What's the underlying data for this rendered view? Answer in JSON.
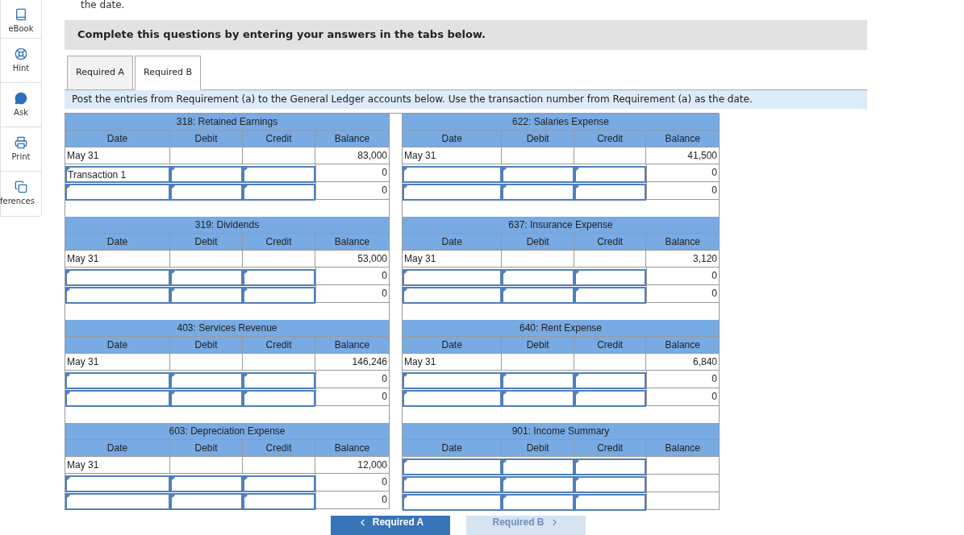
{
  "sidebar": {
    "items": [
      {
        "label": "eBook",
        "kind": "book"
      },
      {
        "label": "Hint",
        "kind": "lifebuoy"
      },
      {
        "label": "Ask",
        "kind": "chat"
      },
      {
        "label": "Print",
        "kind": "printer"
      },
      {
        "label": "ferences",
        "kind": "copies"
      }
    ]
  },
  "top_text": "the date.",
  "instructions": "Complete this questions by entering your answers in the tabs below.",
  "tabs": [
    {
      "label": "Required A",
      "selected": false
    },
    {
      "label": "Required B",
      "selected": true
    }
  ],
  "prompt": "Post the entries from Requirement (a) to the General Ledger accounts below. Use the transaction number from Requirement (a) as the date.",
  "ledgers": [
    {
      "title": "318: Retained Earnings",
      "columns": [
        "Date",
        "Debit",
        "Credit",
        "Balance"
      ],
      "rows": [
        {
          "kind": "fixed",
          "date": "May 31",
          "balance": "83,000"
        },
        {
          "kind": "input",
          "date": "Transaction 1",
          "balance": "0"
        },
        {
          "kind": "input",
          "balance": "0"
        }
      ]
    },
    {
      "title": "622: Salaries Expense",
      "columns": [
        "Date",
        "Debit",
        "Credit",
        "Balance"
      ],
      "rows": [
        {
          "kind": "fixed",
          "date": "May 31",
          "balance": "41,500"
        },
        {
          "kind": "input",
          "balance": "0"
        },
        {
          "kind": "input",
          "balance": "0"
        }
      ]
    },
    {
      "title": "319: Dividends",
      "columns": [
        "Date",
        "Debit",
        "Credit",
        "Balance"
      ],
      "rows": [
        {
          "kind": "fixed",
          "date": "May 31",
          "balance": "53,000"
        },
        {
          "kind": "input",
          "balance": "0"
        },
        {
          "kind": "input",
          "balance": "0"
        }
      ]
    },
    {
      "title": "637: Insurance Expense",
      "columns": [
        "Date",
        "Debit",
        "Credit",
        "Balance"
      ],
      "rows": [
        {
          "kind": "fixed",
          "date": "May 31",
          "balance": "3,120"
        },
        {
          "kind": "input",
          "balance": "0"
        },
        {
          "kind": "input",
          "balance": "0"
        }
      ]
    },
    {
      "title": "403: Services Revenue",
      "columns": [
        "Date",
        "Debit",
        "Credit",
        "Balance"
      ],
      "rows": [
        {
          "kind": "fixed",
          "date": "May 31",
          "balance": "146,246"
        },
        {
          "kind": "input",
          "balance": "0"
        },
        {
          "kind": "input",
          "balance": "0"
        }
      ]
    },
    {
      "title": "640: Rent Expense",
      "columns": [
        "Date",
        "Debit",
        "Credit",
        "Balance"
      ],
      "rows": [
        {
          "kind": "fixed",
          "date": "May 31",
          "balance": "6,840"
        },
        {
          "kind": "input",
          "balance": "0"
        },
        {
          "kind": "input",
          "balance": "0"
        }
      ]
    },
    {
      "title": "603: Depreciation Expense",
      "columns": [
        "Date",
        "Debit",
        "Credit",
        "Balance"
      ],
      "rows": [
        {
          "kind": "fixed",
          "date": "May 31",
          "balance": "12,000"
        },
        {
          "kind": "input",
          "balance": "0"
        },
        {
          "kind": "input",
          "balance": "0"
        }
      ]
    },
    {
      "title": "901: Income Summary",
      "columns": [
        "Date",
        "Debit",
        "Credit",
        "Balance"
      ],
      "rows": [
        {
          "kind": "input"
        },
        {
          "kind": "input"
        },
        {
          "kind": "input"
        }
      ]
    }
  ],
  "nav_buttons": [
    {
      "label": "Required A",
      "kind": "prev",
      "disabled": false
    },
    {
      "label": "Required B",
      "kind": "next",
      "disabled": true
    }
  ]
}
